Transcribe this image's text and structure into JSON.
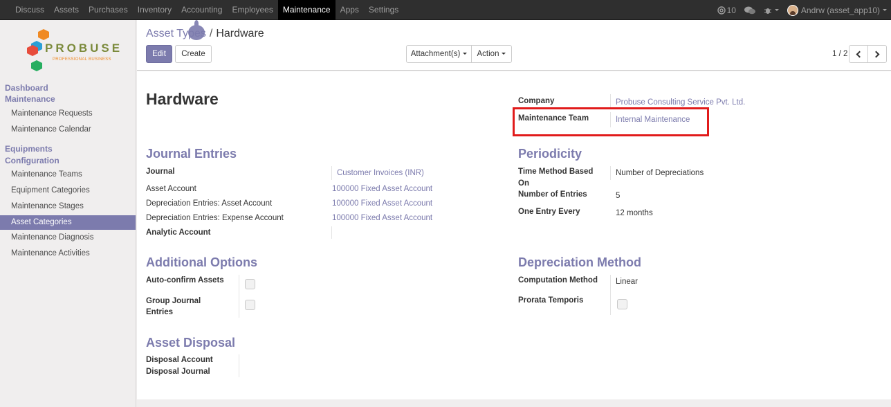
{
  "topbar": {
    "menu": [
      "Discuss",
      "Assets",
      "Purchases",
      "Inventory",
      "Accounting",
      "Employees",
      "Maintenance",
      "Apps",
      "Settings"
    ],
    "active_menu": "Maintenance",
    "messages_count": "10",
    "user_label": "Andrw (asset_app10)"
  },
  "logo": {
    "word": "PROBUSE",
    "tagline": "PROFESSIONAL BUSINESS"
  },
  "sidebar": {
    "section1": "Dashboard",
    "section2": "Maintenance",
    "items1": [
      "Maintenance Requests",
      "Maintenance Calendar"
    ],
    "section3": "Equipments",
    "section4": "Configuration",
    "items2": [
      "Maintenance Teams",
      "Equipment Categories",
      "Maintenance Stages",
      "Asset Categories",
      "Maintenance Diagnosis",
      "Maintenance Activities"
    ]
  },
  "control_panel": {
    "breadcrumb_parent": "Asset Types",
    "breadcrumb_sep": "/",
    "breadcrumb_current": "Hardware",
    "edit_label": "Edit",
    "create_label": "Create",
    "attachments_label": "Attachment(s)",
    "action_label": "Action",
    "pager": "1 / 2"
  },
  "form": {
    "name": "Hardware",
    "company_label": "Company",
    "company_value": "Probuse Consulting Service Pvt. Ltd.",
    "team_label": "Maintenance Team",
    "team_value": "Internal Maintenance",
    "journal_section": "Journal Entries",
    "journal_label": "Journal",
    "journal_value": "Customer Invoices (INR)",
    "asset_account_label": "Asset Account",
    "asset_account_value": "100000 Fixed Asset Account",
    "dep_asset_label": "Depreciation Entries: Asset Account",
    "dep_asset_value": "100000 Fixed Asset Account",
    "dep_expense_label": "Depreciation Entries: Expense Account",
    "dep_expense_value": "100000 Fixed Asset Account",
    "analytic_label": "Analytic Account",
    "periodicity_section": "Periodicity",
    "time_method_label_1": "Time Method Based",
    "time_method_label_2": "On",
    "time_method_value": "Number of Depreciations",
    "num_entries_label": "Number of Entries",
    "num_entries_value": "5",
    "one_entry_label": "One Entry Every",
    "one_entry_value": "12 months",
    "options_section": "Additional Options",
    "auto_confirm_label": "Auto-confirm Assets",
    "group_journal_label_1": "Group Journal",
    "group_journal_label_2": "Entries",
    "dep_method_section": "Depreciation Method",
    "computation_label": "Computation Method",
    "computation_value": "Linear",
    "prorata_label": "Prorata Temporis",
    "disposal_section": "Asset Disposal",
    "disposal_account_label": "Disposal Account",
    "disposal_journal_label": "Disposal Journal"
  }
}
